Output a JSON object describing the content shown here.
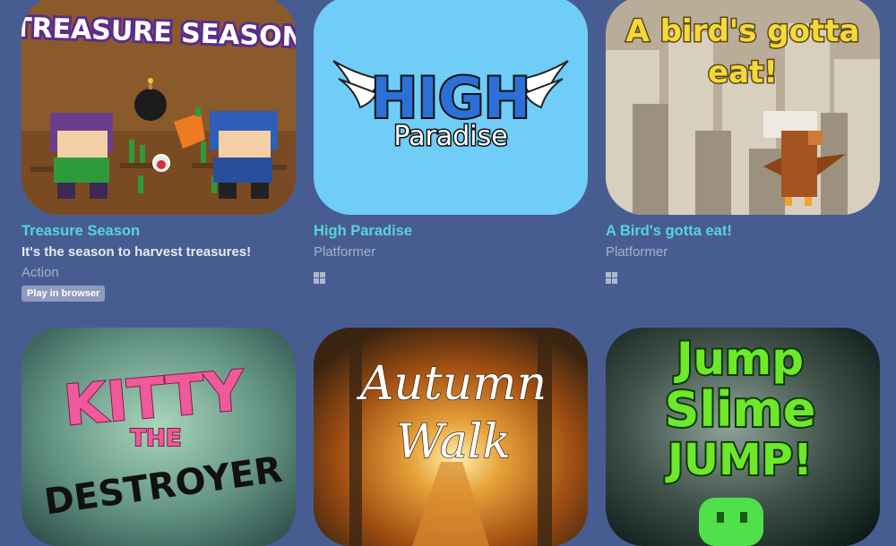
{
  "games": [
    {
      "title": "Treasure Season",
      "cover_text": "TREASURE SEASON",
      "description": "It's the season to harvest treasures!",
      "genre": "Action",
      "badge": "Play in browser"
    },
    {
      "title": "High Paradise",
      "cover_text": [
        "HIGH",
        "Paradise"
      ],
      "genre": "Platformer",
      "platform": "windows-icon"
    },
    {
      "title": "A Bird's gotta eat!",
      "cover_text": [
        "A bird's gotta",
        "eat!"
      ],
      "genre": "Platformer",
      "platform": "windows-icon"
    },
    {
      "cover_text": [
        "KITTY",
        "THE",
        "DESTROYER"
      ]
    },
    {
      "cover_text": [
        "Autumn",
        "Walk"
      ]
    },
    {
      "cover_text": [
        "Jump",
        "Slime",
        "JUMP!"
      ]
    }
  ],
  "colors": {
    "page_bg": "#475d92",
    "title": "#57d5d8",
    "genre": "#a6b0c9"
  }
}
